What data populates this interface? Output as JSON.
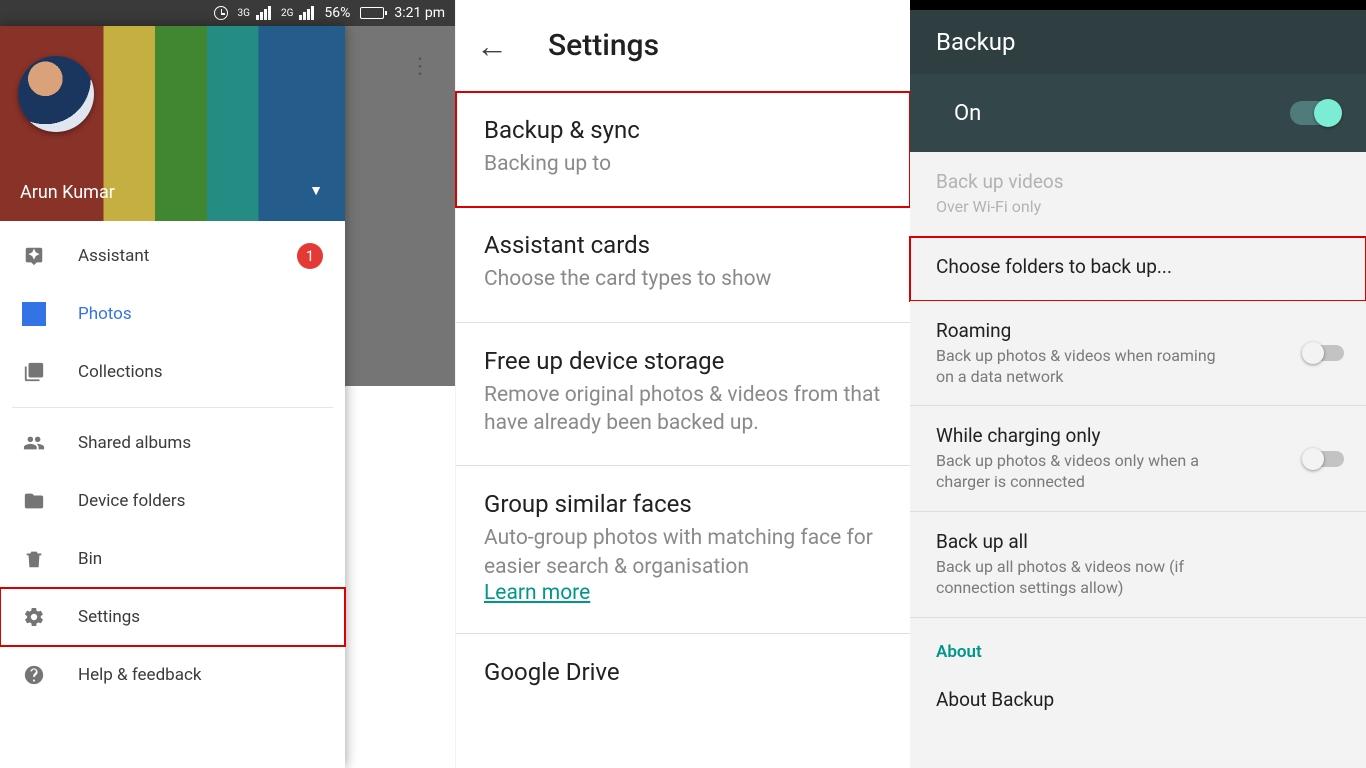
{
  "statusbar": {
    "net1": "3G",
    "net2": "2G",
    "battery_pct": "56%",
    "time": "3:21 pm"
  },
  "drawer": {
    "username": "Arun Kumar",
    "items": {
      "assistant": "Assistant",
      "assistant_badge": "1",
      "photos": "Photos",
      "collections": "Collections",
      "shared": "Shared albums",
      "device_folders": "Device folders",
      "bin": "Bin",
      "settings": "Settings",
      "help": "Help & feedback"
    }
  },
  "settings": {
    "title": "Settings",
    "backup_sync": {
      "title": "Backup & sync",
      "sub": "Backing up to"
    },
    "assistant_cards": {
      "title": "Assistant cards",
      "sub": "Choose the card types to show"
    },
    "free_up": {
      "title": "Free up device storage",
      "sub": "Remove original photos & videos from that have already been backed up."
    },
    "faces": {
      "title": "Group similar faces",
      "sub": "Auto-group photos with matching face for easier search & organisation",
      "link": "Learn more"
    },
    "drive": {
      "title": "Google Drive"
    }
  },
  "backup": {
    "appbar": "Backup",
    "on_label": "On",
    "videos": {
      "title": "Back up videos",
      "sub": "Over Wi-Fi only"
    },
    "choose_folders": "Choose folders to back up...",
    "roaming": {
      "title": "Roaming",
      "sub": "Back up photos & videos when roaming on a data network"
    },
    "charging": {
      "title": "While charging only",
      "sub": "Back up photos & videos only when a charger is connected"
    },
    "backup_all": {
      "title": "Back up all",
      "sub": "Back up all photos & videos now (if connection settings allow)"
    },
    "about_section": "About",
    "about_backup": "About Backup"
  }
}
